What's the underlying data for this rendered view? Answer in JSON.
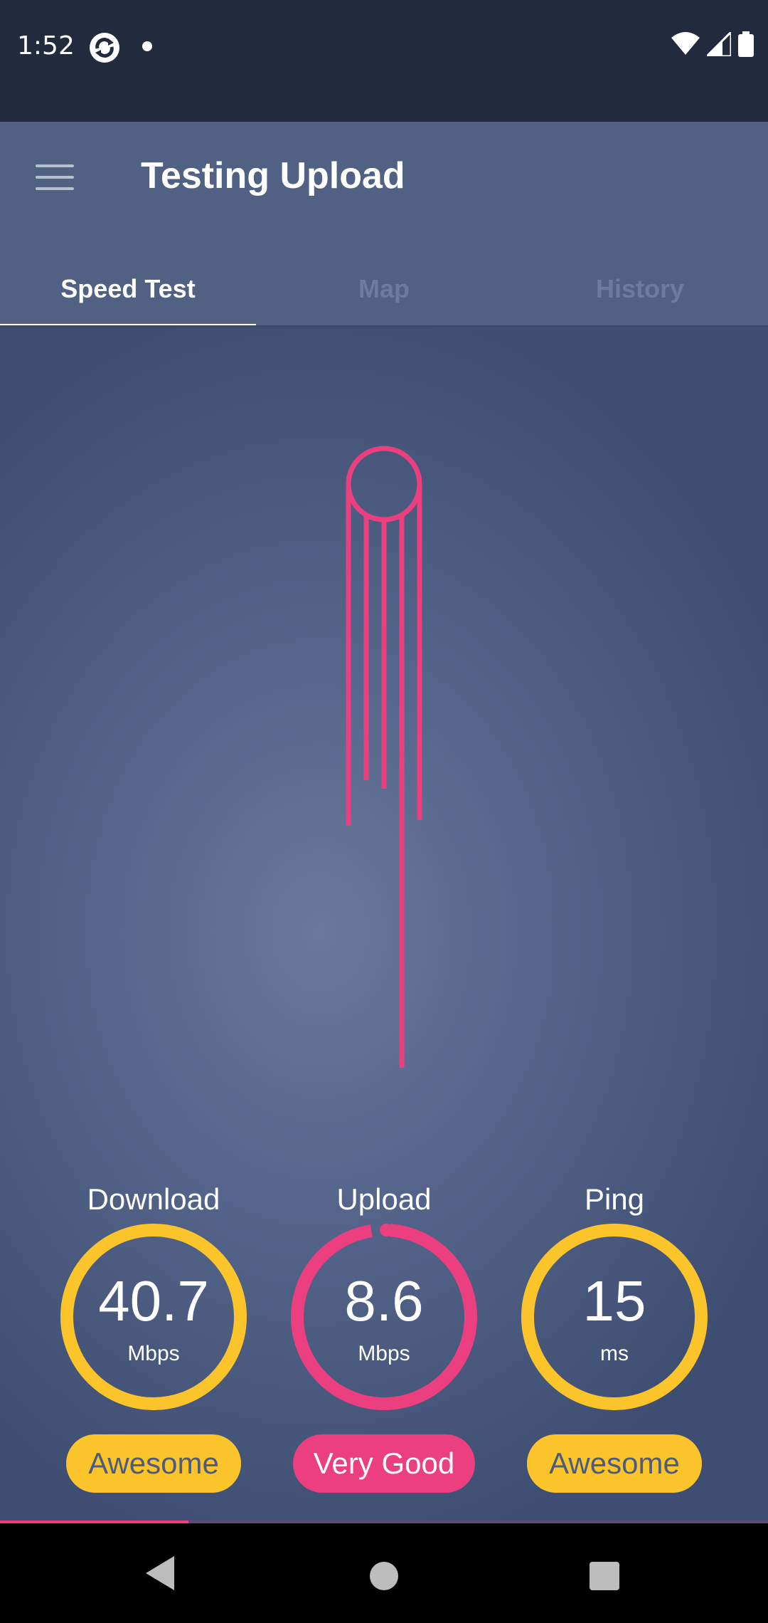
{
  "status_bar": {
    "time": "1:52",
    "icons": [
      "sync-app-icon",
      "notification-dot",
      "wifi-icon",
      "cell-signal-icon",
      "battery-icon"
    ]
  },
  "app_bar": {
    "title": "Testing Upload",
    "menu_icon": "hamburger-menu-icon"
  },
  "tabs": [
    {
      "label": "Speed Test",
      "active": true
    },
    {
      "label": "Map",
      "active": false
    },
    {
      "label": "History",
      "active": false
    }
  ],
  "metrics": {
    "download": {
      "label": "Download",
      "value": "40.7",
      "unit": "Mbps",
      "rating": "Awesome",
      "color": "#fbc42b"
    },
    "upload": {
      "label": "Upload",
      "value": "8.6",
      "unit": "Mbps",
      "rating": "Very Good",
      "color": "#ec3f7f"
    },
    "ping": {
      "label": "Ping",
      "value": "15",
      "unit": "ms",
      "rating": "Awesome",
      "color": "#fbc42b"
    }
  },
  "test_progress": 0.245,
  "colors": {
    "accent_pink": "#ec3f7f",
    "accent_yellow": "#fbc42b",
    "app_bar": "#506184",
    "status_bar": "#222b3d"
  },
  "nav_bar": {
    "icons": [
      "back-icon",
      "home-icon",
      "recents-icon"
    ]
  }
}
